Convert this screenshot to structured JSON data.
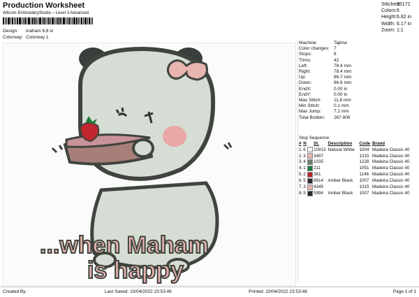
{
  "header": {
    "title": "Production Worksheet",
    "software": "Wilcom EmbroideryStudio – Level 3 Advanced"
  },
  "stats": [
    {
      "label": "Stitches:",
      "value": "35172"
    },
    {
      "label": "Colors:",
      "value": "6"
    },
    {
      "label": "Height:",
      "value": "6.82 in"
    },
    {
      "label": "Width:",
      "value": "6.17 in"
    },
    {
      "label": "Zoom:",
      "value": "1:1"
    }
  ],
  "design_info": {
    "design_label": "Design:",
    "design_value": "maham 6,8 in",
    "colorway_label": "Colorway:",
    "colorway_value": "Colorway 1"
  },
  "machine_info": [
    {
      "label": "Machine:",
      "value": "Tajima"
    },
    {
      "label": "Color changes:",
      "value": "7"
    },
    {
      "label": "Stops:",
      "value": "8"
    },
    {
      "label": "Trims:",
      "value": "42"
    },
    {
      "label": "Left:",
      "value": "78.4 mm"
    },
    {
      "label": "Right:",
      "value": "78.4 mm"
    },
    {
      "label": "Up:",
      "value": "86.7 mm"
    },
    {
      "label": "Down:",
      "value": "86.6 mm"
    },
    {
      "label": "EndX:",
      "value": "0.00 in"
    },
    {
      "label": "EndY:",
      "value": "0.00 in"
    },
    {
      "label": "Max Stitch:",
      "value": "11.8 mm"
    },
    {
      "label": "Min Stitch:",
      "value": "0.1 mm"
    },
    {
      "label": "Max Jump:",
      "value": "7.2 mm"
    },
    {
      "label": "Total Bobbin:",
      "value": "267.80ft"
    }
  ],
  "sequence": {
    "title": "Stop Sequence:",
    "headers": [
      "#",
      "N",
      "",
      "St.",
      "Description",
      "Code",
      "Brand"
    ],
    "rows": [
      {
        "num": "1.",
        "n": "6",
        "color": "#f2f2f2",
        "st": "10913",
        "desc": "Natural White",
        "code": "1004",
        "brand": "Madeira Classic 40"
      },
      {
        "num": "2.",
        "n": "3",
        "color": "#e8b4b0",
        "st": "3497",
        "desc": "",
        "code": "1315",
        "brand": "Madeira Classic 40"
      },
      {
        "num": "3.",
        "n": "4",
        "color": "#6f7f6f",
        "st": "1035",
        "desc": "",
        "code": "1228",
        "brand": "Madeira Classic 40"
      },
      {
        "num": "4.",
        "n": "1",
        "color": "#1f7a3a",
        "st": "211",
        "desc": "",
        "code": "1051",
        "brand": "Madeira Classic 40"
      },
      {
        "num": "5.",
        "n": "2",
        "color": "#b8222a",
        "st": "361",
        "desc": "",
        "code": "1146",
        "brand": "Madeira Classic 40"
      },
      {
        "num": "6.",
        "n": "5",
        "color": "#2a2a2a",
        "st": "8814",
        "desc": "Amber Black",
        "code": "1007",
        "brand": "Madeira Classic 40"
      },
      {
        "num": "7.",
        "n": "3",
        "color": "#e8b4b0",
        "st": "4345",
        "desc": "",
        "code": "1315",
        "brand": "Madeira Classic 40"
      },
      {
        "num": "8.",
        "n": "5",
        "color": "#2a2a2a",
        "st": "5994",
        "desc": "Amber Black",
        "code": "1007",
        "brand": "Madeira Classic 40"
      }
    ]
  },
  "artwork": {
    "caption_line1": "...when Maham",
    "caption_line2": "is happy"
  },
  "footer": {
    "created_by": "Created By:",
    "last_saved": "Last Saved: 10/04/2022 23:53:46",
    "printed": "Printed: 10/04/2022 23:53:48",
    "page": "Page 1 of 1"
  }
}
